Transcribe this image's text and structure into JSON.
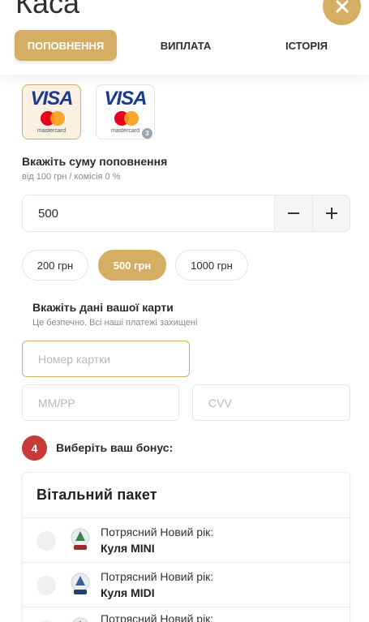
{
  "header": {
    "title": "Каса",
    "close_icon": "close-icon",
    "tabs": [
      {
        "label": "ПОПОВНЕННЯ",
        "active": true
      },
      {
        "label": "ВИПЛАТА",
        "active": false
      },
      {
        "label": "ІСТОРІЯ",
        "active": false
      }
    ]
  },
  "payment_methods": [
    {
      "brand": "VISA",
      "sub": "mastercard",
      "selected": true,
      "badge": ""
    },
    {
      "brand": "VISA",
      "sub": "mastercard",
      "selected": false,
      "badge": "3"
    }
  ],
  "amount": {
    "label": "Вкажіть суму поповнення",
    "hint": "від 100 грн / комісія 0 %",
    "value": "500",
    "minus": "−",
    "plus": "+"
  },
  "presets": [
    {
      "label": "200 грн",
      "active": false
    },
    {
      "label": "500 грн",
      "active": true
    },
    {
      "label": "1000 грн",
      "active": false
    }
  ],
  "card": {
    "label": "Вкажіть дані вашої карти",
    "hint": "Це безпечно. Всі наші платежі захищені",
    "number_placeholder": "Номер картки",
    "expiry_placeholder": "ММ/РР",
    "cvv_placeholder": "CVV"
  },
  "bonus": {
    "step": "4",
    "label": "Виберіть ваш бонус:",
    "panel_title": "Вітальний пакет",
    "items": [
      {
        "line1": "Потрясний Новий рік:",
        "line2": "Куля MINI",
        "icon": "snow-globe-icon"
      },
      {
        "line1": "Потрясний Новий рік:",
        "line2": "Куля MIDI",
        "icon": "snow-globe-icon"
      },
      {
        "line1": "Потрясний Новий рік:",
        "line2": "",
        "icon": "snow-globe-icon"
      }
    ]
  },
  "colors": {
    "accent": "#d5ad63",
    "step_badge": "#c63a3a",
    "visa_blue": "#1a3a8f",
    "mc_red": "#eb001b",
    "mc_orange": "#f79e1b"
  }
}
